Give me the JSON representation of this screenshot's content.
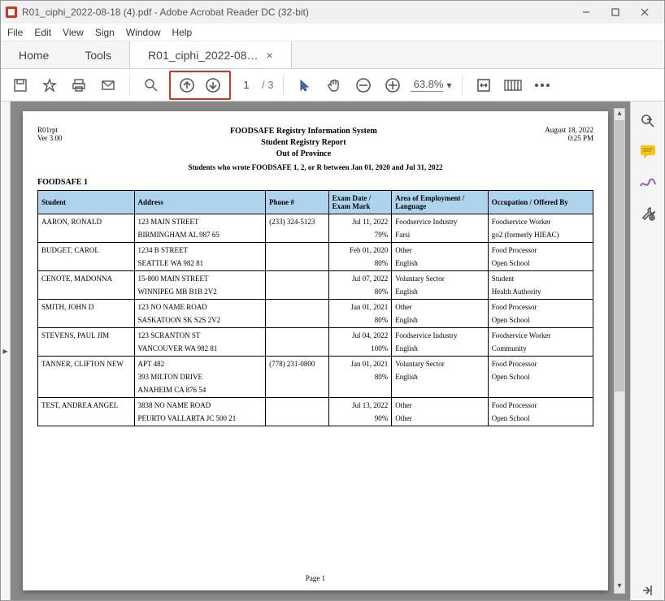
{
  "window": {
    "title": "R01_ciphi_2022-08-18 (4).pdf - Adobe Acrobat Reader DC (32-bit)"
  },
  "menu": {
    "file": "File",
    "edit": "Edit",
    "view": "View",
    "sign": "Sign",
    "window": "Window",
    "help": "Help"
  },
  "tabs": {
    "home": "Home",
    "tools": "Tools",
    "doc": "R01_ciphi_2022-08…"
  },
  "toolbar": {
    "page_current": "1",
    "page_total": "/  3",
    "zoom_value": "63.8%"
  },
  "report": {
    "org": "R01rpt",
    "ver": "Ver 3.00",
    "date": "August 18, 2022",
    "time": "0:25 PM",
    "title1": "FOODSAFE Registry Information System",
    "title2": "Student Registry Report",
    "title3": "Out of Province",
    "criteria": "Students who wrote FOODSAFE 1, 2, or R between Jan 01, 2020 and Jul 31, 2022",
    "section": "FOODSAFE 1",
    "page_label": "Page 1",
    "cols": {
      "student": "Student",
      "address": "Address",
      "phone": "Phone #",
      "exam": "Exam Date / Exam Mark",
      "area": "Area of Employment / Language",
      "occ": "Occupation / Offered By"
    },
    "rows": [
      {
        "student": "AARON, RONALD",
        "addr1": "123 MAIN STREET",
        "addr2": "BIRMINGHAM  AL  987 65",
        "phone": "(233) 324-5123",
        "date": "Jul 11, 2022",
        "mark": "79%",
        "area1": "Foodservice Industry",
        "area2": "Farsi",
        "occ1": "Foodservice Worker",
        "occ2": "go2 (formerly HIEAC)"
      },
      {
        "student": "BUDGET, CAROL",
        "addr1": "1234 B STREET",
        "addr2": "SEATTLE  WA  982 81",
        "phone": "",
        "date": "Feb 01, 2020",
        "mark": "80%",
        "area1": "Other",
        "area2": "English",
        "occ1": "Food Processor",
        "occ2": "Open School"
      },
      {
        "student": "CENOTE, MADONNA",
        "addr1": "15-800 MAIN STREET",
        "addr2": "WINNIPEG  MB  B1B 2V2",
        "phone": "",
        "date": "Jul 07, 2022",
        "mark": "80%",
        "area1": "Voluntary Sector",
        "area2": "English",
        "occ1": "Student",
        "occ2": "Health Authority"
      },
      {
        "student": "SMITH, JOHN D",
        "addr1": "123 NO NAME ROAD",
        "addr2": "SASKATOON  SK  S2S 2V2",
        "phone": "",
        "date": "Jan 01, 2021",
        "mark": "80%",
        "area1": "Other",
        "area2": "English",
        "occ1": "Food Processor",
        "occ2": "Open School"
      },
      {
        "student": "STEVENS, PAUL JIM",
        "addr1": "123 SCRANTON ST",
        "addr2": "VANCOUVER  WA  982 81",
        "phone": "",
        "date": "Jul 04, 2022",
        "mark": "100%",
        "area1": "Foodservice Industry",
        "area2": "English",
        "occ1": "Foodservice Worker",
        "occ2": "Community"
      },
      {
        "student": "TANNER, CLIFTON NEW",
        "addr1": "APT 482",
        "addr2": "393 MILTON DRIVE",
        "addr3": "ANAHEIM  CA  876 54",
        "phone": "(778) 231-0800",
        "date": "Jan 01, 2021",
        "mark": "80%",
        "area1": "Voluntary Sector",
        "area2": "English",
        "occ1": "Food Processor",
        "occ2": "Open School"
      },
      {
        "student": "TEST, ANDREA ANGEL",
        "addr1": "3838 NO NAME ROAD",
        "addr2": "PEURTO VALLARTA  JC  500 21",
        "phone": "",
        "date": "Jul 13, 2022",
        "mark": "90%",
        "area1": "Other",
        "area2": "Other",
        "occ1": "Food Processor",
        "occ2": "Open School"
      }
    ]
  }
}
